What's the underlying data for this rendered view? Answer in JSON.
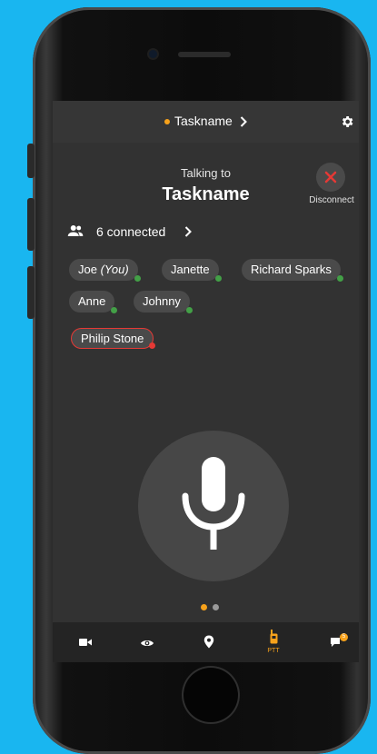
{
  "header": {
    "task_name": "Taskname",
    "task_color": "#f7a21b"
  },
  "call": {
    "talking_label": "Talking to",
    "target": "Taskname",
    "disconnect_label": "Disconnect"
  },
  "connected": {
    "label": "6 connected"
  },
  "participants": [
    {
      "name": "Joe",
      "suffix": "(You)",
      "status": "online"
    },
    {
      "name": "Janette",
      "status": "online"
    },
    {
      "name": "Richard Sparks",
      "status": "online"
    },
    {
      "name": "Anne",
      "status": "online"
    },
    {
      "name": "Johnny",
      "status": "online"
    },
    {
      "name": "Philip Stone",
      "status": "speaking"
    }
  ],
  "pager": {
    "count": 2,
    "active": 1
  },
  "nav": {
    "items": [
      {
        "icon": "video-camera-icon"
      },
      {
        "icon": "eye-icon"
      },
      {
        "icon": "location-pin-icon"
      },
      {
        "icon": "walkie-talkie-icon",
        "label": "PTT",
        "active": true
      },
      {
        "icon": "chat-icon",
        "badge": "5"
      }
    ]
  },
  "colors": {
    "accent": "#f7a21b",
    "online": "#43a047",
    "speaking": "#e53935"
  }
}
